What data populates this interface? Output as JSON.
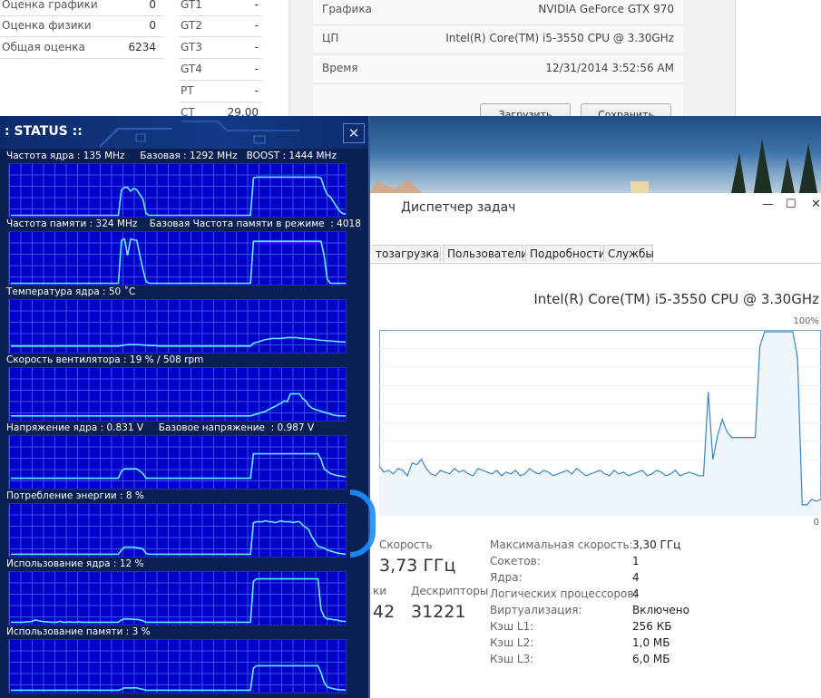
{
  "scores": {
    "rows": [
      {
        "label": "Оценка графики",
        "value": "0"
      },
      {
        "label": "Оценка физики",
        "value": "0"
      },
      {
        "label": "Общая оценка",
        "value": "6234"
      }
    ],
    "gt_rows": [
      {
        "label": "GT1",
        "value": "-"
      },
      {
        "label": "GT2",
        "value": "-"
      },
      {
        "label": "GT3",
        "value": "-"
      },
      {
        "label": "GT4",
        "value": "-"
      },
      {
        "label": "PT",
        "value": "-"
      },
      {
        "label": "CT",
        "value": "29.00"
      }
    ]
  },
  "system": {
    "rows": [
      {
        "label": "Графика",
        "value": "NVIDIA GeForce GTX 970"
      },
      {
        "label": "ЦП",
        "value": "Intel(R) Core(TM) i5-3550 CPU @ 3.30GHz"
      },
      {
        "label": "Время",
        "value": "12/31/2014 3:52:56 AM"
      }
    ],
    "load_button": "Загрузить",
    "save_button": "Сохранить"
  },
  "taskmanager": {
    "title": "Диспетчер задач",
    "tabs": [
      "тозагрузка",
      "Пользователи",
      "Подробности",
      "Службы"
    ],
    "cpu_name": "Intel(R) Core(TM) i5-3550 CPU @ 3.30GHz",
    "pct_max": "100%",
    "pct_min": "0",
    "speed_label": "Скорость",
    "speed_value": "3,73 ГГц",
    "threads_label": "ки",
    "threads_value": "42",
    "handles_label": "Дескрипторы",
    "handles_value": "31221",
    "details": [
      {
        "label": "Максимальная скорость:",
        "value": "3,30 ГГц"
      },
      {
        "label": "Сокетов:",
        "value": "1"
      },
      {
        "label": "Ядра:",
        "value": "4"
      },
      {
        "label": "Логических процессоров:",
        "value": "4"
      },
      {
        "label": "Виртуализация:",
        "value": "Включено"
      },
      {
        "label": "Кэш L1:",
        "value": "256 КБ"
      },
      {
        "label": "Кэш L2:",
        "value": "1,0 МБ"
      },
      {
        "label": "Кэш L3:",
        "value": "6,0 МБ"
      }
    ],
    "cpu_history": [
      26,
      23,
      24,
      22,
      25,
      24,
      21,
      28,
      27,
      30,
      25,
      22,
      21,
      24,
      23,
      22,
      25,
      23,
      24,
      22,
      21,
      25,
      24,
      23,
      22,
      24,
      21,
      23,
      22,
      24,
      21,
      22,
      25,
      23,
      22,
      24,
      23,
      21,
      22,
      23,
      24,
      22,
      25,
      23,
      21,
      22,
      23,
      24,
      22,
      21,
      24,
      22,
      23,
      21,
      22,
      23,
      24,
      21,
      22,
      24,
      23,
      21,
      22,
      24,
      21,
      22,
      23,
      22,
      21,
      21,
      67,
      30,
      43,
      52,
      45,
      42,
      42,
      42,
      42,
      42,
      42,
      92,
      100,
      100,
      100,
      100,
      100,
      100,
      100,
      86,
      5,
      5,
      8,
      7,
      8
    ]
  },
  "status": {
    "title": ": STATUS ::",
    "close_glyph": "✕",
    "monitors": [
      {
        "label": "Частота ядра : 135 MHz     Базовая : 1292 MHz   BOOST : 1444 MHz",
        "series": [
          1,
          1,
          1,
          1,
          1,
          1,
          1,
          1,
          1,
          1,
          1,
          1,
          1,
          1,
          1,
          1,
          1,
          1,
          1,
          1,
          1,
          1,
          1,
          1,
          1,
          1,
          1,
          1,
          1,
          1,
          1,
          1,
          1,
          1,
          1,
          1,
          55,
          60,
          60,
          52,
          58,
          55,
          45,
          35,
          5,
          1,
          1,
          1,
          1,
          1,
          1,
          1,
          1,
          1,
          1,
          1,
          1,
          1,
          1,
          1,
          1,
          1,
          1,
          1,
          1,
          1,
          1,
          1,
          1,
          1,
          1,
          1,
          1,
          1,
          1,
          1,
          1,
          1,
          1,
          80,
          82,
          82,
          82,
          82,
          82,
          82,
          82,
          82,
          82,
          82,
          82,
          82,
          82,
          82,
          82,
          82,
          82,
          82,
          82,
          82,
          82,
          80,
          60,
          45,
          40,
          30,
          20,
          10,
          5,
          3
        ]
      },
      {
        "label": "Частота памяти : 324 MHz    Базовая Частота памяти в режиме  : 4018",
        "series": [
          1,
          1,
          1,
          1,
          1,
          1,
          1,
          1,
          1,
          1,
          1,
          1,
          1,
          1,
          1,
          1,
          1,
          1,
          1,
          1,
          1,
          1,
          1,
          1,
          1,
          1,
          1,
          1,
          1,
          1,
          1,
          1,
          1,
          1,
          1,
          1,
          92,
          95,
          60,
          95,
          93,
          92,
          60,
          30,
          5,
          1,
          1,
          1,
          1,
          1,
          1,
          1,
          1,
          1,
          1,
          1,
          1,
          1,
          1,
          1,
          1,
          1,
          1,
          1,
          1,
          1,
          1,
          1,
          1,
          1,
          1,
          1,
          1,
          1,
          1,
          1,
          1,
          1,
          1,
          90,
          90,
          90,
          90,
          90,
          90,
          90,
          90,
          90,
          90,
          90,
          90,
          90,
          90,
          90,
          90,
          90,
          90,
          90,
          90,
          90,
          90,
          90,
          60,
          10,
          1,
          1,
          1,
          1,
          1,
          1
        ]
      },
      {
        "label": "Температура ядра : 50 ˚C",
        "series": [
          12,
          12,
          12,
          12,
          12,
          12,
          12,
          12,
          12,
          12,
          12,
          12,
          12,
          12,
          12,
          12,
          12,
          12,
          12,
          12,
          12,
          12,
          12,
          12,
          12,
          12,
          12,
          12,
          12,
          12,
          12,
          12,
          12,
          12,
          12,
          12,
          13,
          14,
          15,
          15,
          15,
          15,
          15,
          14,
          14,
          13,
          13,
          13,
          12,
          12,
          12,
          12,
          12,
          12,
          12,
          12,
          12,
          12,
          12,
          12,
          12,
          12,
          12,
          12,
          12,
          12,
          12,
          12,
          12,
          12,
          12,
          12,
          12,
          12,
          12,
          12,
          12,
          12,
          12,
          18,
          20,
          22,
          24,
          26,
          27,
          28,
          28,
          28,
          28,
          29,
          30,
          30,
          30,
          30,
          29,
          28,
          28,
          27,
          27,
          26,
          25,
          24,
          24,
          23,
          23,
          22,
          22,
          21,
          21,
          20
        ]
      },
      {
        "label": "Скорость вентилятора : 19 % / 508 rpm",
        "series": [
          8,
          8,
          8,
          8,
          8,
          8,
          8,
          8,
          8,
          8,
          8,
          8,
          8,
          8,
          8,
          8,
          8,
          8,
          8,
          8,
          8,
          8,
          8,
          8,
          8,
          8,
          8,
          8,
          8,
          8,
          8,
          8,
          8,
          8,
          8,
          8,
          8,
          8,
          8,
          8,
          8,
          8,
          8,
          8,
          8,
          8,
          8,
          8,
          8,
          8,
          8,
          8,
          8,
          8,
          8,
          8,
          8,
          8,
          8,
          8,
          8,
          8,
          8,
          8,
          8,
          8,
          8,
          8,
          8,
          8,
          8,
          8,
          8,
          8,
          8,
          8,
          8,
          8,
          8,
          10,
          12,
          14,
          16,
          18,
          22,
          25,
          28,
          32,
          35,
          40,
          38,
          55,
          55,
          55,
          55,
          45,
          40,
          30,
          25,
          22,
          20,
          18,
          16,
          14,
          12,
          10,
          9,
          8,
          8,
          8
        ]
      },
      {
        "label": "Напряжение ядра : 0.831 V     Базовое напряжение  : 0.987 V",
        "series": [
          20,
          20,
          20,
          20,
          20,
          20,
          20,
          20,
          20,
          20,
          20,
          20,
          20,
          20,
          20,
          20,
          20,
          20,
          20,
          20,
          20,
          20,
          20,
          20,
          20,
          20,
          20,
          20,
          20,
          20,
          20,
          20,
          20,
          20,
          20,
          20,
          35,
          40,
          40,
          40,
          40,
          40,
          35,
          30,
          20,
          20,
          20,
          20,
          20,
          20,
          20,
          20,
          20,
          20,
          20,
          20,
          20,
          20,
          20,
          20,
          20,
          20,
          20,
          20,
          20,
          20,
          20,
          20,
          20,
          20,
          20,
          20,
          20,
          20,
          20,
          20,
          20,
          20,
          20,
          72,
          72,
          72,
          72,
          72,
          72,
          72,
          72,
          72,
          72,
          72,
          72,
          72,
          72,
          72,
          72,
          72,
          72,
          72,
          72,
          72,
          72,
          60,
          40,
          35,
          30,
          28,
          26,
          25,
          24,
          23
        ]
      },
      {
        "label": "Потребление энергии : 8 %",
        "series": [
          3,
          3,
          3,
          3,
          3,
          3,
          3,
          3,
          3,
          3,
          3,
          3,
          3,
          3,
          3,
          3,
          3,
          3,
          3,
          3,
          3,
          3,
          3,
          3,
          3,
          3,
          3,
          3,
          3,
          3,
          3,
          3,
          3,
          3,
          3,
          3,
          12,
          18,
          18,
          18,
          18,
          17,
          16,
          14,
          5,
          3,
          3,
          3,
          3,
          3,
          3,
          3,
          3,
          3,
          3,
          3,
          3,
          3,
          3,
          3,
          3,
          3,
          3,
          3,
          3,
          3,
          3,
          3,
          3,
          3,
          3,
          3,
          3,
          3,
          3,
          3,
          3,
          3,
          3,
          70,
          72,
          72,
          72,
          74,
          72,
          72,
          70,
          72,
          74,
          72,
          72,
          72,
          70,
          72,
          72,
          65,
          60,
          55,
          40,
          30,
          20,
          18,
          16,
          12,
          10,
          8,
          6,
          5,
          4,
          3
        ]
      },
      {
        "label": "Использование ядра : 12 %",
        "series": [
          3,
          3,
          3,
          3,
          3,
          4,
          4,
          5,
          8,
          6,
          5,
          4,
          4,
          3,
          3,
          3,
          5,
          3,
          3,
          4,
          3,
          3,
          4,
          3,
          3,
          3,
          3,
          3,
          3,
          3,
          3,
          3,
          3,
          3,
          3,
          3,
          8,
          10,
          10,
          10,
          9,
          9,
          8,
          6,
          3,
          3,
          3,
          3,
          3,
          3,
          3,
          3,
          3,
          3,
          3,
          3,
          3,
          3,
          3,
          3,
          3,
          3,
          3,
          3,
          3,
          3,
          3,
          3,
          3,
          3,
          3,
          3,
          3,
          3,
          3,
          3,
          3,
          3,
          3,
          90,
          95,
          95,
          95,
          95,
          95,
          95,
          95,
          95,
          95,
          95,
          95,
          95,
          95,
          95,
          95,
          95,
          95,
          95,
          95,
          95,
          95,
          30,
          15,
          10,
          10,
          8,
          8,
          6,
          5,
          5
        ]
      },
      {
        "label": "Использование памяти : 3 %",
        "series": [
          3,
          3,
          3,
          3,
          3,
          3,
          3,
          3,
          3,
          3,
          3,
          3,
          3,
          3,
          3,
          3,
          3,
          3,
          3,
          3,
          3,
          3,
          3,
          3,
          3,
          3,
          3,
          3,
          3,
          3,
          3,
          3,
          3,
          3,
          3,
          3,
          5,
          8,
          8,
          8,
          8,
          8,
          6,
          5,
          3,
          3,
          3,
          3,
          3,
          3,
          3,
          3,
          3,
          3,
          3,
          3,
          3,
          3,
          3,
          3,
          3,
          3,
          3,
          3,
          3,
          3,
          3,
          3,
          3,
          3,
          3,
          3,
          3,
          3,
          3,
          3,
          3,
          3,
          3,
          50,
          55,
          55,
          55,
          55,
          55,
          55,
          55,
          55,
          55,
          55,
          55,
          55,
          55,
          55,
          55,
          55,
          55,
          55,
          55,
          55,
          55,
          40,
          20,
          10,
          8,
          6,
          5,
          4,
          4,
          3
        ]
      }
    ]
  }
}
